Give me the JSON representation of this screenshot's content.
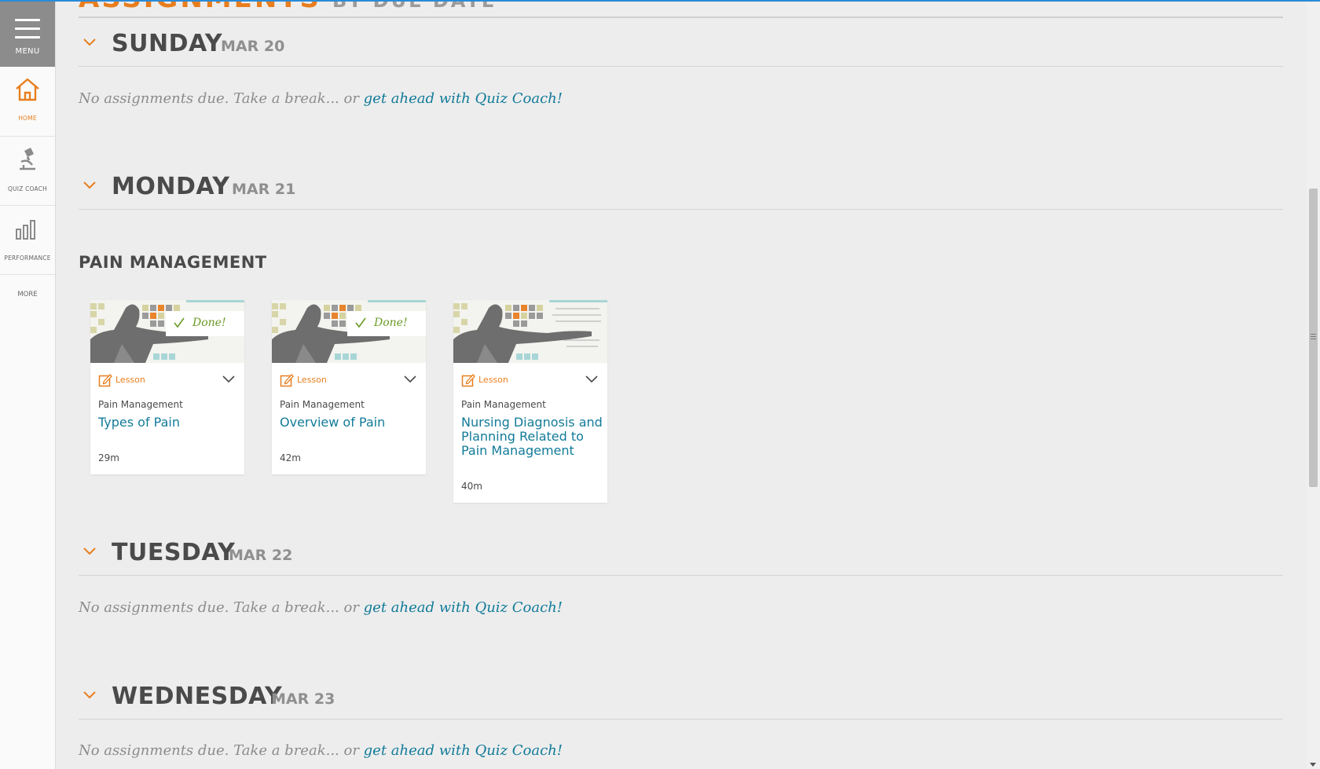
{
  "sidebar": {
    "menu_label": "MENU",
    "items": [
      {
        "label": "HOME",
        "icon": "home-icon"
      },
      {
        "label": "QUIZ COACH",
        "icon": "microscope-icon"
      },
      {
        "label": "PERFORMANCE",
        "icon": "bar-chart-icon"
      }
    ],
    "more_label": "MORE"
  },
  "page": {
    "title": "ASSIGNMENTS",
    "subtitle": "BY DUE DATE"
  },
  "empty_message": {
    "text": "No assignments due. Take a break... or ",
    "link": "get ahead with Quiz Coach!"
  },
  "days": [
    {
      "day": "SUNDAY",
      "date": "MAR 20"
    },
    {
      "day": "MONDAY",
      "date": "MAR 21"
    },
    {
      "day": "TUESDAY",
      "date": "MAR 22"
    },
    {
      "day": "WEDNESDAY",
      "date": "MAR 23"
    }
  ],
  "monday": {
    "topic": "PAIN MANAGEMENT",
    "cards": [
      {
        "type": "Lesson",
        "course": "Pain Management",
        "title": "Types of Pain",
        "duration": "29m",
        "status": "Done!"
      },
      {
        "type": "Lesson",
        "course": "Pain Management",
        "title": "Overview of Pain",
        "duration": "42m",
        "status": "Done!"
      },
      {
        "type": "Lesson",
        "course": "Pain Management",
        "title": "Nursing Diagnosis and Planning Related to Pain Management",
        "duration": "40m",
        "status": ""
      }
    ]
  },
  "colors": {
    "accent_orange": "#e87e1e",
    "link_teal": "#127b99",
    "done_green": "#6b9a26",
    "menu_gray": "#8c8c8c"
  }
}
